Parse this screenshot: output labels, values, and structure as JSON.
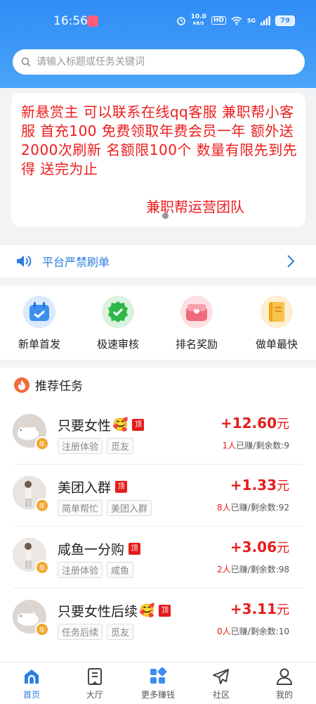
{
  "status_bar": {
    "time": "16:56",
    "net_speed_top": "10.0",
    "net_speed_unit": "KB/S",
    "hd": "HD",
    "signal": "5G",
    "battery": "79"
  },
  "search": {
    "placeholder": "请输入标题或任务关键词"
  },
  "notice": {
    "text": "新悬赏主 可以联系在线qq客服 兼职帮小客服 首充100 免费领取年费会员一年 额外送2000次刷新 名额限100个 数量有限先到先得 送完为止",
    "signature": "兼职帮运营团队"
  },
  "announcement": {
    "label": "平台严禁刷单"
  },
  "quick_menu": [
    {
      "label": "新单首发",
      "icon": "calendar-icon",
      "color": "#3d8ef0"
    },
    {
      "label": "极速审核",
      "icon": "check-badge-icon",
      "color": "#2fb84a"
    },
    {
      "label": "排名奖励",
      "icon": "gift-box-icon",
      "color": "#f06a7a"
    },
    {
      "label": "做单最快",
      "icon": "book-icon",
      "color": "#f3a51c"
    }
  ],
  "tasks_section": {
    "title": "推荐任务",
    "items": [
      {
        "title": "只要女性",
        "emoji": "🥰",
        "top": "顶",
        "tags": [
          "注册体验",
          "觅友"
        ],
        "reward": "+12.60",
        "unit": "元",
        "earned": "1人",
        "rest": "已赚/剩余数:9",
        "badge": "年"
      },
      {
        "title": "美团入群",
        "emoji": "",
        "top": "顶",
        "tags": [
          "简单帮忙",
          "美团入群"
        ],
        "reward": "+1.33",
        "unit": "元",
        "earned": "8人",
        "rest": "已赚/剩余数:92",
        "badge": "年"
      },
      {
        "title": "咸鱼一分购",
        "emoji": "",
        "top": "顶",
        "tags": [
          "注册体验",
          "咸鱼"
        ],
        "reward": "+3.06",
        "unit": "元",
        "earned": "2人",
        "rest": "已赚/剩余数:98",
        "badge": "年"
      },
      {
        "title": "只要女性后续",
        "emoji": "🥰",
        "top": "顶",
        "tags": [
          "任务后续",
          "觅友"
        ],
        "reward": "+3.11",
        "unit": "元",
        "earned": "0人",
        "rest": "已赚/剩余数:10",
        "badge": "年"
      }
    ]
  },
  "tabbar": [
    {
      "label": "首页",
      "icon": "home-icon",
      "active": true
    },
    {
      "label": "大厅",
      "icon": "hall-icon",
      "active": false
    },
    {
      "label": "更多赚钱",
      "icon": "apps-icon",
      "active": false
    },
    {
      "label": "社区",
      "icon": "send-icon",
      "active": false
    },
    {
      "label": "我的",
      "icon": "user-icon",
      "active": false
    }
  ],
  "colors": {
    "accent": "#2c7de0",
    "reward": "#e61c1c",
    "header": "#3a97f6"
  }
}
